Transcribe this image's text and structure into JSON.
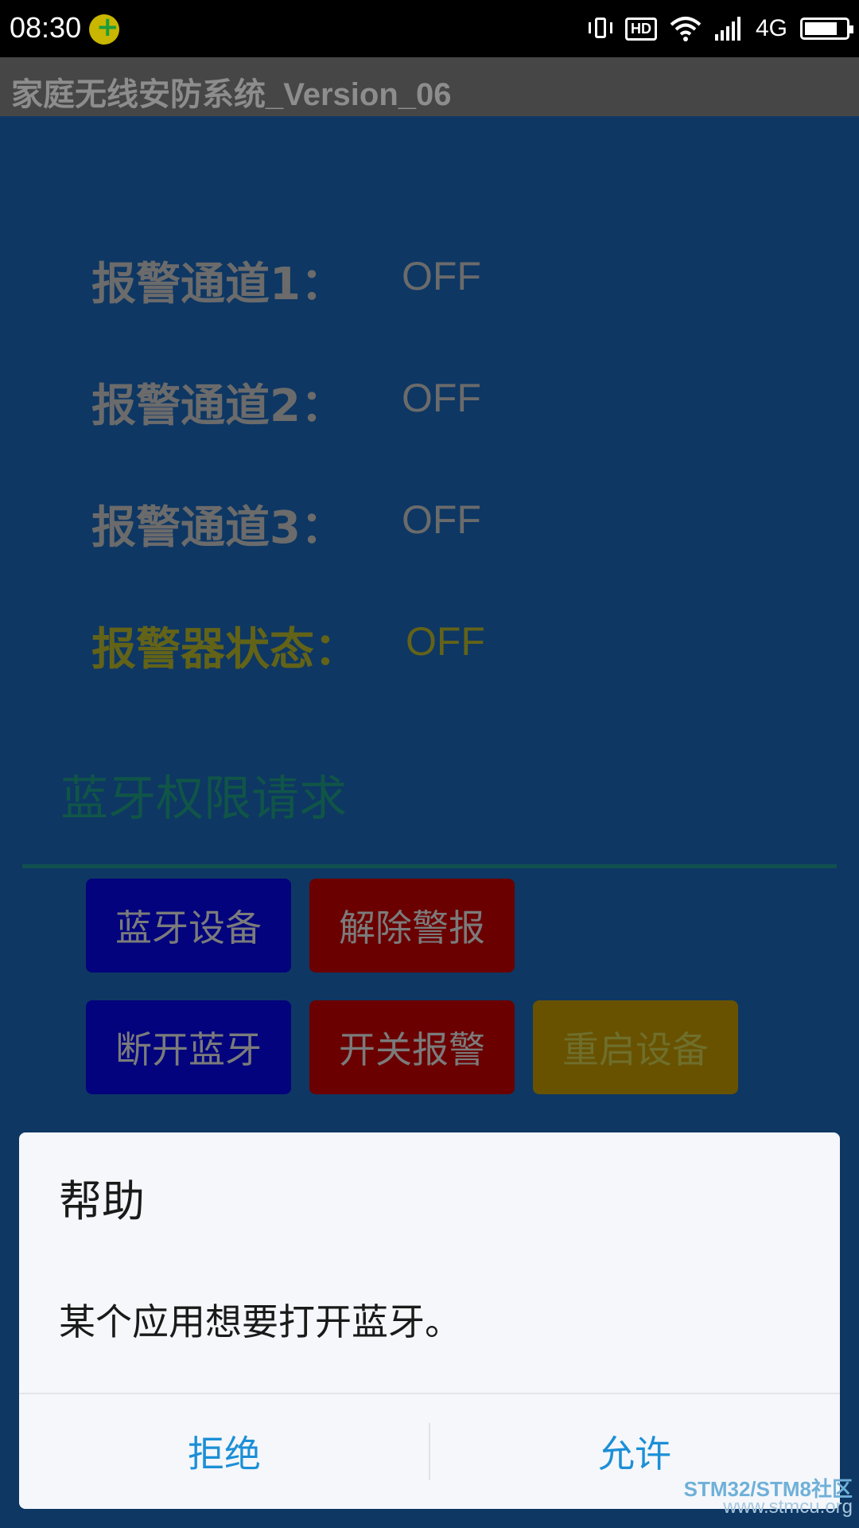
{
  "status_bar": {
    "time": "08:30",
    "hd": "HD",
    "network": "4G",
    "battery_level": 0.8,
    "icons": [
      "app-notification-icon",
      "vibrate-icon",
      "hd-icon",
      "wifi-icon",
      "signal-icon",
      "battery-icon"
    ]
  },
  "app": {
    "title": "家庭无线安防系统_Version_06"
  },
  "channels": [
    {
      "label": "报警通道1：",
      "value": "OFF"
    },
    {
      "label": "报警通道2：",
      "value": "OFF"
    },
    {
      "label": "报警通道3：",
      "value": "OFF"
    }
  ],
  "alarm_status": {
    "label": "报警器状态：",
    "value": "OFF"
  },
  "bluetooth_heading": "蓝牙权限请求",
  "buttons": {
    "bluetooth_devices": "蓝牙设备",
    "clear_alarm": "解除警报",
    "disconnect_bluetooth": "断开蓝牙",
    "toggle_alarm": "开关报警",
    "restart_device": "重启设备"
  },
  "dialog": {
    "title": "帮助",
    "message": "某个应用想要打开蓝牙。",
    "deny": "拒绝",
    "allow": "允许"
  },
  "watermark": {
    "line1": "STM32/STM8社区",
    "line2": "www.stmcu.org"
  },
  "colors": {
    "background": "#0e3763",
    "dialog_accent": "#1c8fd6",
    "btn_blue": "#02037d",
    "btn_red": "#6b0000",
    "btn_amber": "#685200"
  }
}
